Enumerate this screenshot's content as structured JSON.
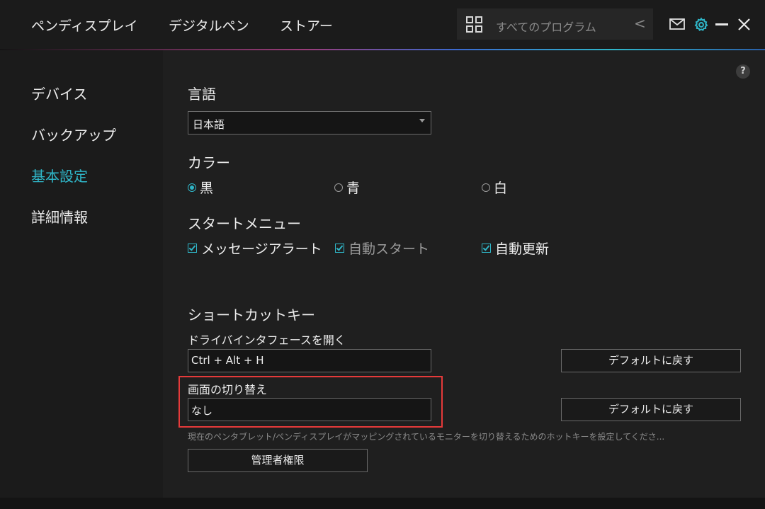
{
  "topnav": {
    "items": [
      "ペンディスプレイ",
      "デジタルペン",
      "ストアー"
    ],
    "search_placeholder": "すべてのプログラム",
    "back_symbol": "<"
  },
  "sidebar": {
    "items": [
      {
        "label": "デバイス",
        "active": false
      },
      {
        "label": "バックアップ",
        "active": false
      },
      {
        "label": "基本設定",
        "active": true
      },
      {
        "label": "詳細情報",
        "active": false
      }
    ]
  },
  "main": {
    "help_symbol": "?",
    "language": {
      "title": "言語",
      "value": "日本語"
    },
    "color": {
      "title": "カラー",
      "options": [
        {
          "label": "黒",
          "checked": true
        },
        {
          "label": "青",
          "checked": false
        },
        {
          "label": "白",
          "checked": false
        }
      ]
    },
    "start_menu": {
      "title": "スタートメニュー",
      "options": [
        {
          "label": "メッセージアラート",
          "checked": true
        },
        {
          "label": "自動スタート",
          "checked": true
        },
        {
          "label": "自動更新",
          "checked": true
        }
      ]
    },
    "shortcut": {
      "title": "ショートカットキー",
      "items": [
        {
          "label": "ドライバインタフェースを開く",
          "value": "Ctrl + Alt + H",
          "reset_label": "デフォルトに戻す"
        },
        {
          "label": "画面の切り替え",
          "value": "なし",
          "reset_label": "デフォルトに戻す"
        }
      ],
      "hint": "現在のペンタブレット/ペンディスプレイがマッピングされているモニターを切り替えるためのホットキーを設定してくださ...",
      "admin_button": "管理者権限"
    }
  },
  "colors": {
    "accent": "#2fb6c8",
    "highlight": "#e53a3a",
    "background": "#1e1e1e"
  }
}
